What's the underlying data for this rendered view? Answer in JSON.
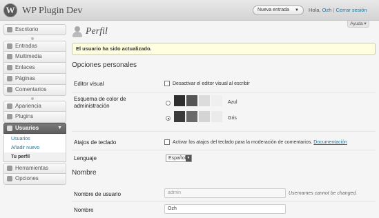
{
  "header": {
    "logo_glyph": "W",
    "site_title": "WP Plugin Dev",
    "new_post_button": "Nueva entrada",
    "greeting_prefix": "Hola,",
    "user_name": "Ozh",
    "separator": "|",
    "logout_link": "Cerrar sesión"
  },
  "help_tab": "Ayuda",
  "sidebar": {
    "items": [
      {
        "label": "Escritorio",
        "icon": "dashboard-icon"
      },
      {
        "label": "Entradas",
        "icon": "pin-icon"
      },
      {
        "label": "Multimedia",
        "icon": "media-icon"
      },
      {
        "label": "Enlaces",
        "icon": "links-icon"
      },
      {
        "label": "Páginas",
        "icon": "pages-icon"
      },
      {
        "label": "Comentarios",
        "icon": "comments-icon"
      },
      {
        "label": "Apariencia",
        "icon": "appearance-icon"
      },
      {
        "label": "Plugins",
        "icon": "plugins-icon"
      },
      {
        "label": "Usuarios",
        "icon": "users-icon"
      },
      {
        "label": "Herramientas",
        "icon": "tools-icon"
      },
      {
        "label": "Opciones",
        "icon": "settings-icon"
      }
    ],
    "users_submenu": [
      "Usuarios",
      "Añadir nuevo",
      "Tu perfil"
    ],
    "active_item": "Usuarios",
    "current_subitem": "Tu perfil"
  },
  "page": {
    "title": "Perfil",
    "notice": "El usuario ha sido actualizado.",
    "personal_options_heading": "Opciones personales",
    "visual_editor_label": "Editor visual",
    "visual_editor_option": "Desactivar el editor visual al escribir",
    "color_scheme_label": "Esquema de color de administración",
    "color_schemes": [
      {
        "name": "Azul",
        "checked": false,
        "colors": [
          "#2e2e2e",
          "#555555",
          "#dcdcdc",
          "#efefef"
        ]
      },
      {
        "name": "Gris",
        "checked": true,
        "colors": [
          "#3a3a3a",
          "#6a6a6a",
          "#d4d4d4",
          "#ebebeb"
        ]
      }
    ],
    "keyboard_shortcuts_label": "Atajos de teclado",
    "keyboard_shortcuts_option": "Activar los atajos del teclado para la moderación de comentarios.",
    "keyboard_shortcuts_link": "Documentación",
    "language_label": "Lenguaje",
    "language_value": "Español",
    "name_heading": "Nombre",
    "username_label": "Nombre de usuario",
    "username_value": "admin",
    "username_hint": "Usernames cannot be changed.",
    "name_label": "Nombre",
    "name_value": "Ozh"
  }
}
